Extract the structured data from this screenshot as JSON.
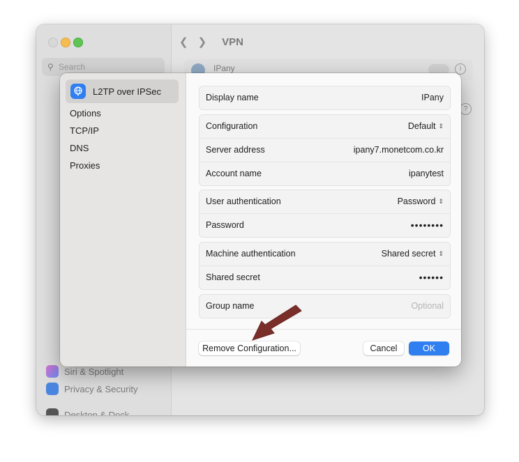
{
  "background": {
    "window_title": "VPN",
    "search_placeholder": "Search",
    "vpn_row_label": "IPany",
    "sidebar_items": [
      "Siri & Spotlight",
      "Privacy & Security",
      "Desktop & Dock"
    ]
  },
  "dialog": {
    "sidebar": {
      "selected": "L2TP over IPSec",
      "items": [
        "Options",
        "TCP/IP",
        "DNS",
        "Proxies"
      ]
    },
    "fields": {
      "display_name": {
        "label": "Display name",
        "value": "IPany"
      },
      "configuration": {
        "label": "Configuration",
        "value": "Default"
      },
      "server_address": {
        "label": "Server address",
        "value": "ipany7.monetcom.co.kr"
      },
      "account_name": {
        "label": "Account name",
        "value": "ipanytest"
      },
      "user_authentication": {
        "label": "User authentication",
        "value": "Password"
      },
      "password": {
        "label": "Password",
        "value": "••••••••"
      },
      "machine_authentication": {
        "label": "Machine authentication",
        "value": "Shared secret"
      },
      "shared_secret": {
        "label": "Shared secret",
        "value": "••••••"
      },
      "group_name": {
        "label": "Group name",
        "placeholder": "Optional"
      }
    },
    "buttons": {
      "remove": "Remove Configuration...",
      "cancel": "Cancel",
      "ok": "OK"
    }
  },
  "colors": {
    "accent": "#2f7ff0",
    "annotation_arrow": "#7a2e2a"
  }
}
